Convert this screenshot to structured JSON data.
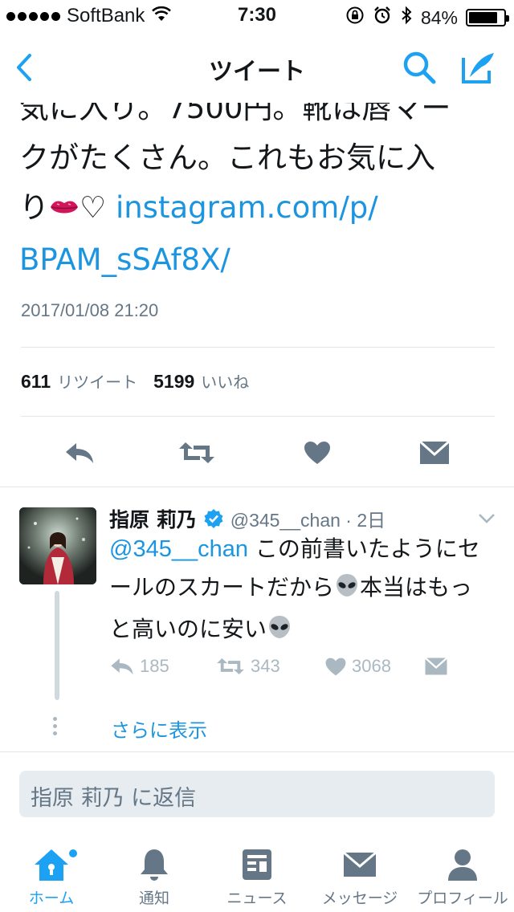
{
  "status_bar": {
    "carrier": "SoftBank",
    "time": "7:30",
    "battery": "84%",
    "battery_level": 0.84
  },
  "nav": {
    "title": "ツイート"
  },
  "tweet": {
    "text_line1": "気に入り。7500円。靴は唇マー",
    "text_line2": "クがたくさん。これもお気に入",
    "text_line3_prefix": "り",
    "text_line3_heart": "♡",
    "link_line1": "instagram.com/p/",
    "link_line2": "BPAM_sSAf8X/",
    "date": "2017/01/08 21:20",
    "retweets_count": "611",
    "retweets_label": "リツイート",
    "likes_count": "5199",
    "likes_label": "いいね"
  },
  "reply": {
    "name": "指原 莉乃",
    "handle_time": "@345__chan · 2日",
    "mention": "@345__chan",
    "text1": " この前書いたようにセ",
    "text2": "ールのスカートだから",
    "text3": "本当はもっ",
    "text4": "と高いのに安い",
    "reply_count": "185",
    "retweet_count": "343",
    "like_count": "3068",
    "show_more": "さらに表示"
  },
  "reply_box": {
    "placeholder": "指原 莉乃 に返信"
  },
  "tab_bar": {
    "items": [
      {
        "label": "ホーム",
        "icon": "home-icon"
      },
      {
        "label": "通知",
        "icon": "bell-icon"
      },
      {
        "label": "ニュース",
        "icon": "news-icon"
      },
      {
        "label": "メッセージ",
        "icon": "mail-icon"
      },
      {
        "label": "プロフィール",
        "icon": "person-icon"
      }
    ]
  },
  "colors": {
    "accent": "#1da1f2",
    "link": "#1b95e0",
    "icon_gray": "#657786",
    "light_gray": "#aab8c2"
  }
}
